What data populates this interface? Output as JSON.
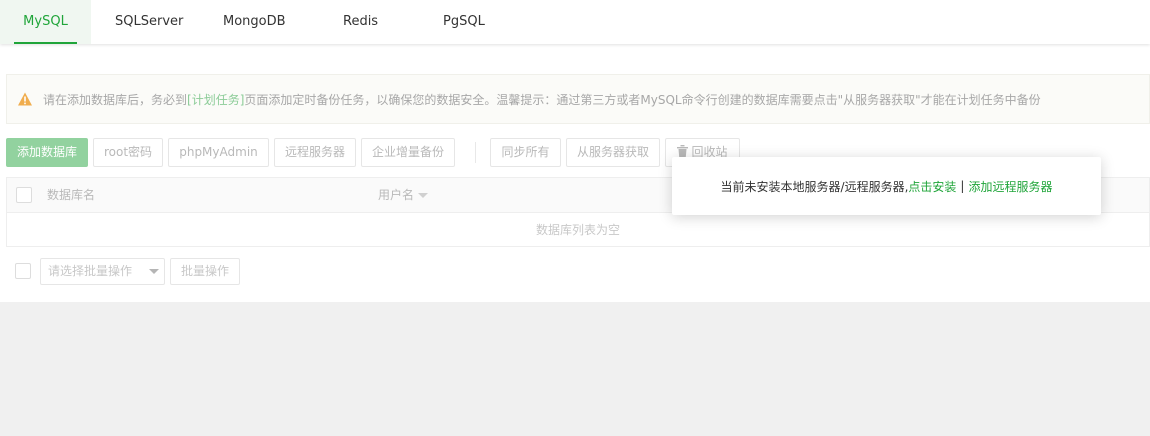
{
  "tabs": [
    {
      "label": "MySQL",
      "active": true
    },
    {
      "label": "SQLServer",
      "active": false
    },
    {
      "label": "MongoDB",
      "active": false
    },
    {
      "label": "Redis",
      "active": false
    },
    {
      "label": "PgSQL",
      "active": false
    }
  ],
  "notice": {
    "icon": "warning-icon",
    "text_before": "请在添加数据库后，务必到",
    "link": "[计划任务]",
    "text_after": "页面添加定时备份任务，以确保您的数据安全。温馨提示：通过第三方或者MySQL命令行创建的数据库需要点击\"从服务器获取\"才能在计划任务中备份"
  },
  "toolbar": {
    "add_database": "添加数据库",
    "root_password": "root密码",
    "phpmyadmin": "phpMyAdmin",
    "remote_server": "远程服务器",
    "incremental_backup": "企业增量备份",
    "sync_all": "同步所有",
    "get_from_server": "从服务器获取",
    "recycle_bin": "回收站"
  },
  "table": {
    "columns": [
      "数据库名",
      "用户名"
    ],
    "empty_text": "数据库列表为空"
  },
  "batch": {
    "select_placeholder": "请选择批量操作",
    "button": "批量操作"
  },
  "popup": {
    "message": "当前未安装本地服务器/远程服务器,",
    "install_link": "点击安装",
    "separator": "|",
    "add_remote_link": "添加远程服务器"
  },
  "colors": {
    "accent": "#20a53a",
    "primary_button": "#92d29f",
    "warning": "#f0ad4e"
  }
}
